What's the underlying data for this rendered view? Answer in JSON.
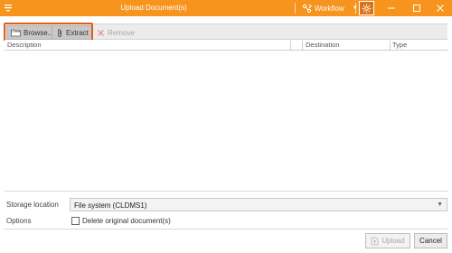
{
  "window": {
    "title": "Upload Document(s)",
    "workflow_label": "Workflow",
    "accent_color": "#f7941d"
  },
  "toolbar": {
    "browse_label": "Browse...",
    "extract_label": "Extract",
    "remove_label": "Remove",
    "highlight_color": "#e8591a"
  },
  "grid": {
    "columns": [
      "Description",
      "Destination",
      "Type"
    ]
  },
  "form": {
    "storage_location_label": "Storage location",
    "storage_location_value": "File system (CLDMS1)",
    "options_label": "Options",
    "delete_original_label": "Delete original document(s)",
    "delete_original_checked": false
  },
  "footer": {
    "upload_label": "Upload",
    "cancel_label": "Cancel"
  }
}
